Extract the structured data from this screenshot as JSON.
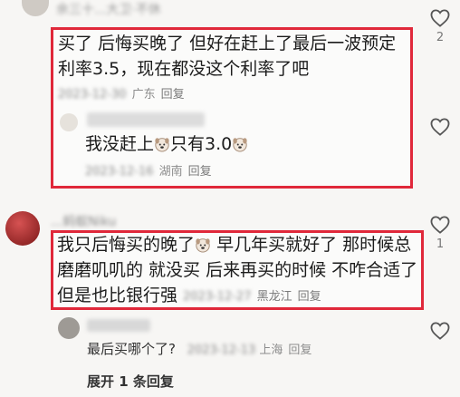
{
  "top_comment": {
    "username_partial": "余三十...大卫·不休"
  },
  "comment1": {
    "text": "买了 后悔买晚了 但好在赶上了最后一波预定利率3.5，现在都没这个利率了吧",
    "date": "2023-12-30",
    "location": "广东",
    "reply_label": "回复",
    "likes": "2"
  },
  "reply1": {
    "username": "...",
    "text": "我没赶上",
    "text2": "只有3.0",
    "date": "2023-12-16",
    "location": "湖南",
    "reply_label": "回复"
  },
  "comment2": {
    "username": "...蚂蚁Niku",
    "text_a": "我只后悔买的晚了",
    "text_b": "早几年买就好了 那时候总磨磨叽叽的 就没买 后来再买的时候 不咋合适了 但是也比银行强",
    "date": "2023-12-27",
    "location": "黑龙江",
    "reply_label": "回复",
    "likes": "1"
  },
  "reply2": {
    "text": "最后买哪个了?",
    "date": "2023-12-13",
    "location": "上海",
    "reply_label": "回复"
  },
  "expand": {
    "label": "展开 1 条回复"
  },
  "colors": {
    "highlight": "#e0283a",
    "text": "#1c1c1c",
    "meta": "#8c8c8c"
  },
  "icons": [
    "heart-outline-icon",
    "dog-emoji-icon"
  ]
}
